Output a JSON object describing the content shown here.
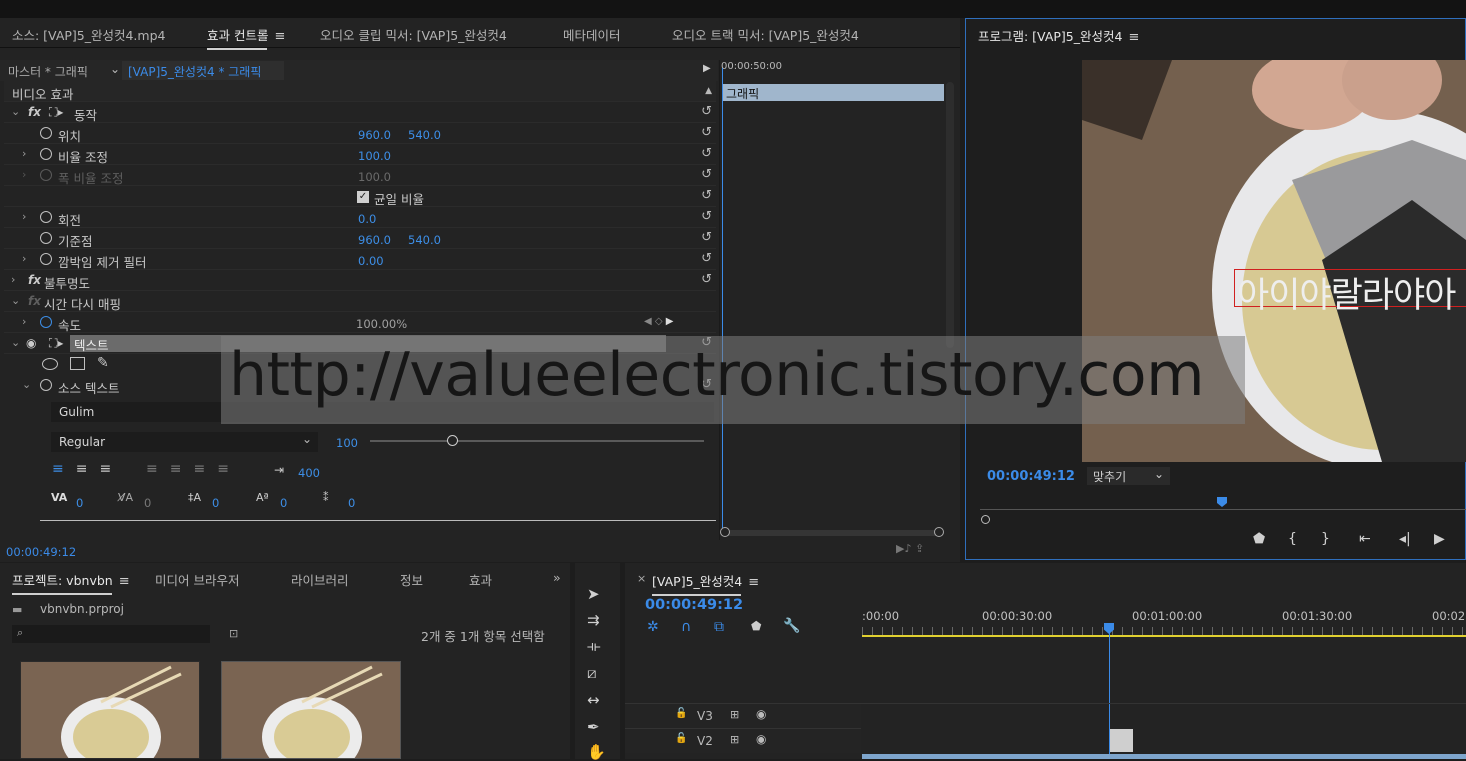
{
  "top_tabs": {
    "source": "소스: [VAP]5_완성컷4.mp4",
    "effect_controls": "효과 컨트롤",
    "audio_clip_mixer": "오디오 클립 믹서: [VAP]5_완성컷4",
    "metadata": "메타데이터",
    "audio_track_mixer": "오디오 트랙 믹서: [VAP]5_완성컷4"
  },
  "ec": {
    "master": "마스터 * 그래픽",
    "seq_clip": "[VAP]5_완성컷4 * 그래픽",
    "video_effects": "비디오 효과",
    "motion": "동작",
    "position_label": "위치",
    "position_x": "960.0",
    "position_y": "540.0",
    "scale_label": "비율 조정",
    "scale_value": "100.0",
    "scale_width_label": "폭 비율 조정",
    "scale_width_value": "100.0",
    "uniform_scale": "균일 비율",
    "rotation_label": "회전",
    "rotation_value": "0.0",
    "anchor_label": "기준점",
    "anchor_x": "960.0",
    "anchor_y": "540.0",
    "flicker_label": "깜박임 제거 필터",
    "flicker_value": "0.00",
    "opacity": "불투명도",
    "time_remap": "시간 다시 매핑",
    "speed_label": "속도",
    "speed_value": "100.00%",
    "text": "텍스트",
    "source_text": "소스 텍스트",
    "font": "Gulim",
    "font_style": "Regular",
    "font_size": "100",
    "tab_width": "400",
    "tracking": "0",
    "kerning": "0",
    "leading": "0",
    "baseline": "0",
    "tsume": "0",
    "timecode": "00:00:49:12"
  },
  "mini_timeline": {
    "ruler_time": "00:00:50:00",
    "clip_label": "그래픽"
  },
  "watermark": "http://valueelectronic.tistory.com",
  "program": {
    "title": "프로그램: [VAP]5_완성컷4",
    "timecode": "00:00:49:12",
    "fit": "맞추기",
    "overlay_text": "아이야랄라야아"
  },
  "project": {
    "tab_project": "프로젝트: vbnvbn",
    "tab_media": "미디어 브라우저",
    "tab_library": "라이브러리",
    "tab_info": "정보",
    "tab_effects": "효과",
    "file": "vbnvbn.prproj",
    "selection": "2개 중 1개 항목 선택함"
  },
  "sequence": {
    "tab": "[VAP]5_완성컷4",
    "timecode": "00:00:49:12",
    "ruler": [
      ":00:00",
      "00:00:30:00",
      "00:01:00:00",
      "00:01:30:00",
      "00:02"
    ],
    "tracks": [
      "V3",
      "V2"
    ]
  },
  "colors": {
    "accent": "#3b8be8",
    "panel": "#232323",
    "clip": "#a0b6cc",
    "timeline_range": "#e0d030"
  }
}
